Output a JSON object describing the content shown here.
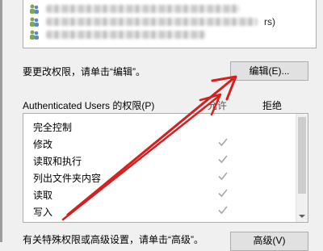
{
  "users": [
    {
      "icon": "user-group-icon",
      "tail": ""
    },
    {
      "icon": "user-group-icon",
      "tail": "rs)"
    },
    {
      "icon": "user-group-icon",
      "tail": ""
    }
  ],
  "edit_hint": "要更改权限，请单击“编辑”。",
  "edit_button": "编辑(E)...",
  "permissions_label": "Authenticated Users 的权限(P)",
  "column_allow": "允许",
  "column_deny": "拒绝",
  "permissions": [
    {
      "name": "完全控制",
      "allow": false
    },
    {
      "name": "修改",
      "allow": true
    },
    {
      "name": "读取和执行",
      "allow": true
    },
    {
      "name": "列出文件夹内容",
      "allow": true
    },
    {
      "name": "读取",
      "allow": true
    },
    {
      "name": "写入",
      "allow": true
    }
  ],
  "advanced_hint": "有关特殊权限或高级设置，请单击“高级”。",
  "advanced_button": "高级(V)",
  "annotation_color": "#d42020"
}
